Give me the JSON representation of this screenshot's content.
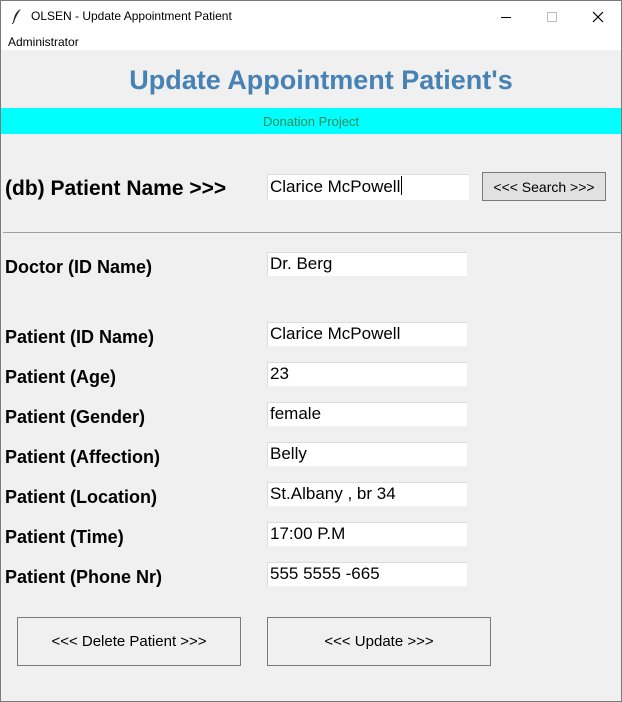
{
  "window": {
    "title": "OLSEN - Update Appointment Patient",
    "menu": "Administrator"
  },
  "heading": "Update Appointment Patient's",
  "banner": "Donation Project",
  "search": {
    "label": "(db) Patient Name >>>",
    "value": "Clarice McPowell",
    "button": "<<< Search >>>"
  },
  "doctor": {
    "label": "Doctor (ID Name)",
    "value": "Dr. Berg"
  },
  "fields": [
    {
      "label": "Patient (ID Name)",
      "value": "Clarice McPowell"
    },
    {
      "label": "Patient (Age)",
      "value": "23"
    },
    {
      "label": "Patient (Gender)",
      "value": "female"
    },
    {
      "label": "Patient (Affection)",
      "value": "Belly"
    },
    {
      "label": "Patient (Location)",
      "value": "St.Albany , br 34"
    },
    {
      "label": "Patient (Time)",
      "value": "17:00 P.M"
    },
    {
      "label": "Patient (Phone Nr)",
      "value": "555 5555 -665"
    }
  ],
  "actions": {
    "delete": "<<< Delete Patient >>>",
    "update": "<<< Update >>>"
  },
  "colors": {
    "heading": "#4682b4",
    "banner_bg": "#00ffff",
    "banner_text": "#2e8b57"
  }
}
